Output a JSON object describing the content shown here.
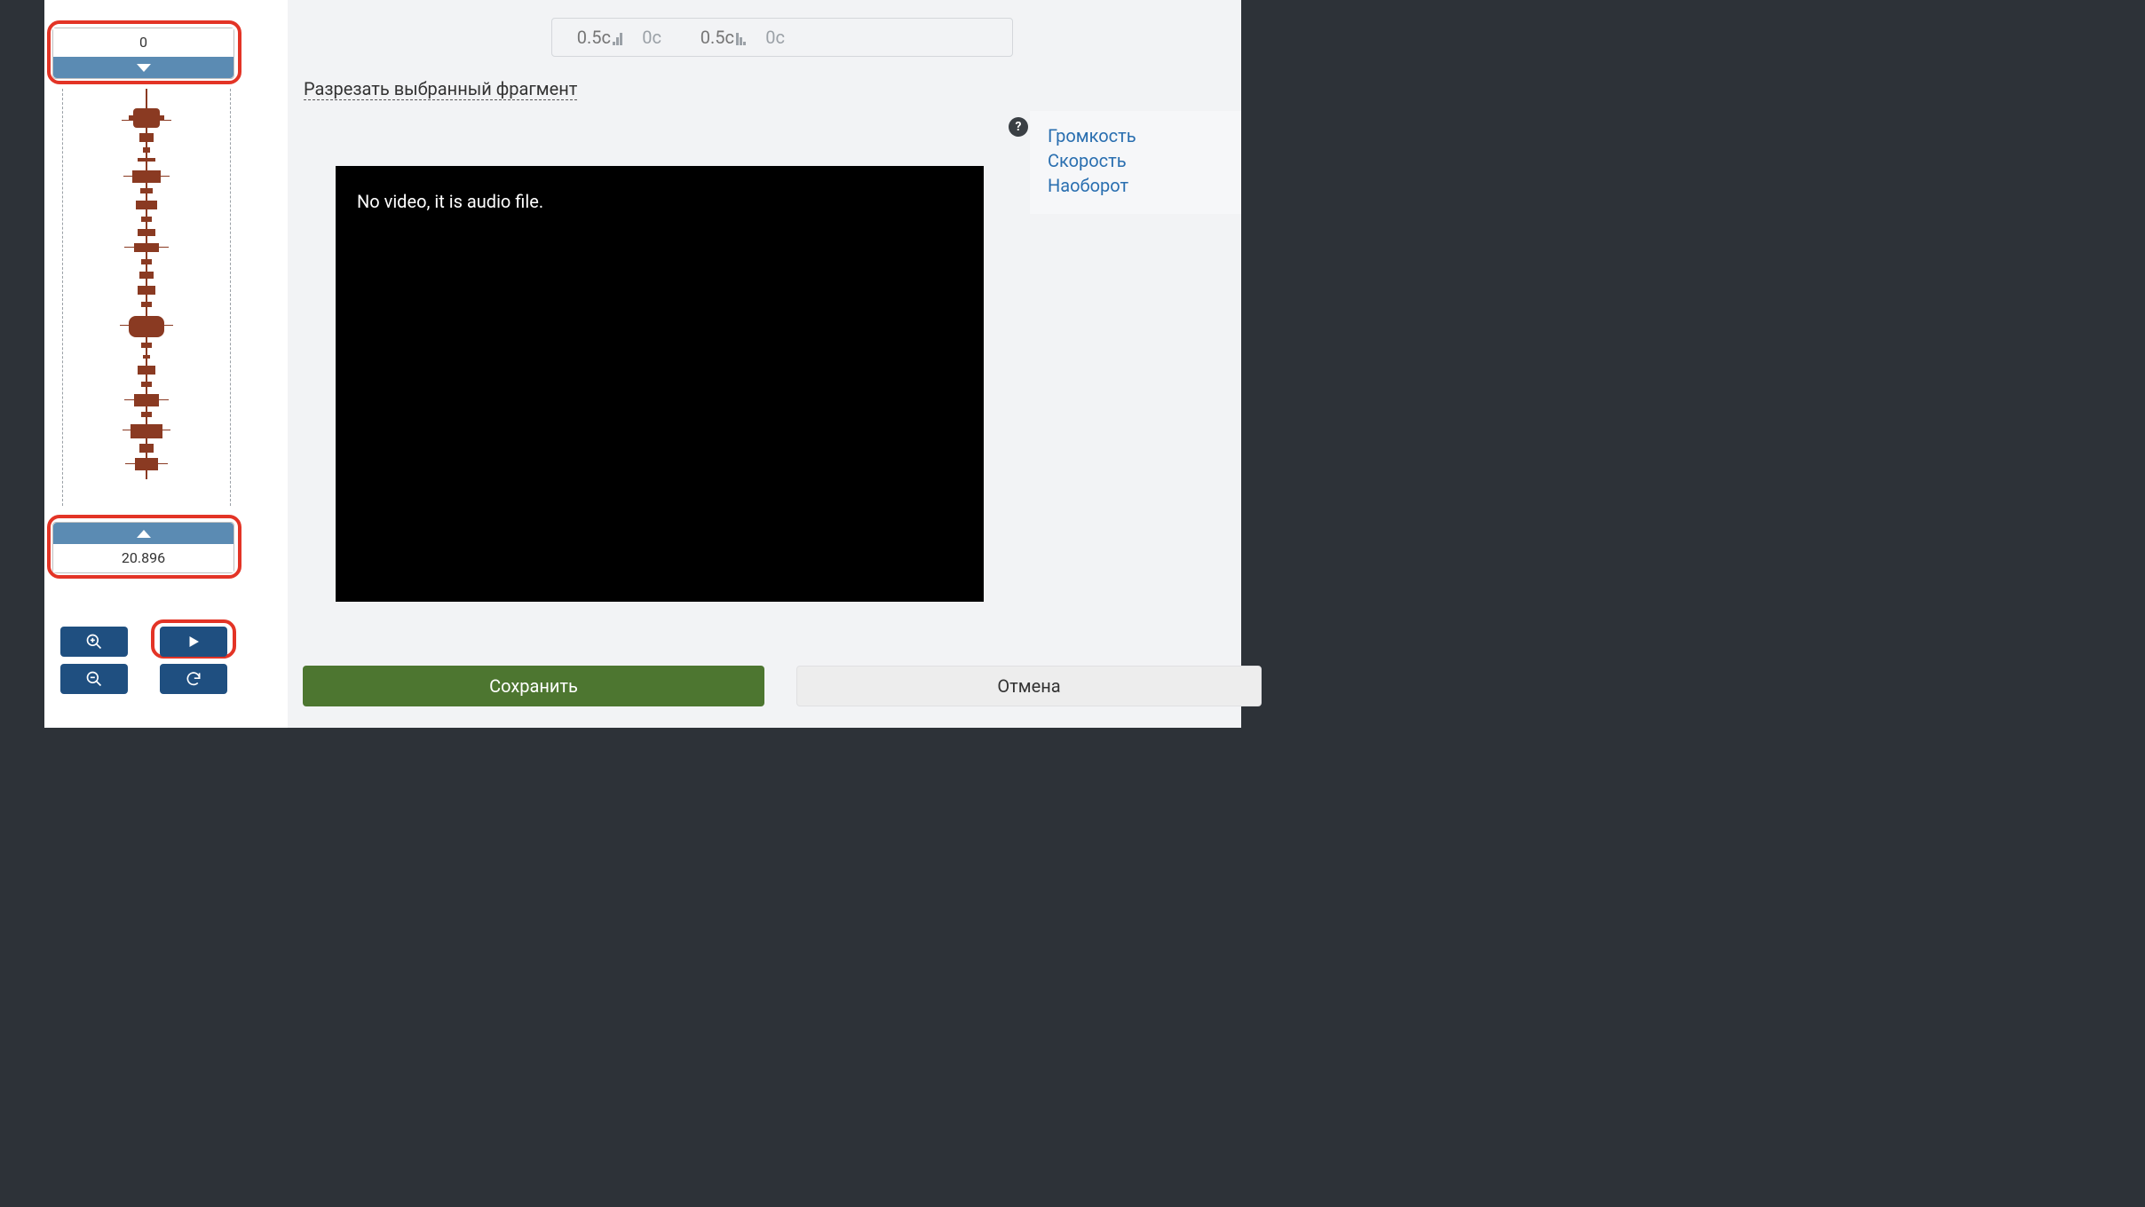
{
  "markers": {
    "start_value": "0",
    "end_value": "20.896"
  },
  "top_controls": {
    "fade_in_placeholder": "0.5с",
    "fade_in_value": "0с",
    "fade_out_placeholder": "0.5с",
    "fade_out_value": "0с"
  },
  "cut_link": "Разрезать выбранный фрагмент",
  "video_message": "No video, it is audio file.",
  "side_links": {
    "volume": "Громкость",
    "speed": "Скорость",
    "reverse": "Наоборот"
  },
  "help_glyph": "?",
  "buttons": {
    "save": "Сохранить",
    "cancel": "Отмена"
  }
}
